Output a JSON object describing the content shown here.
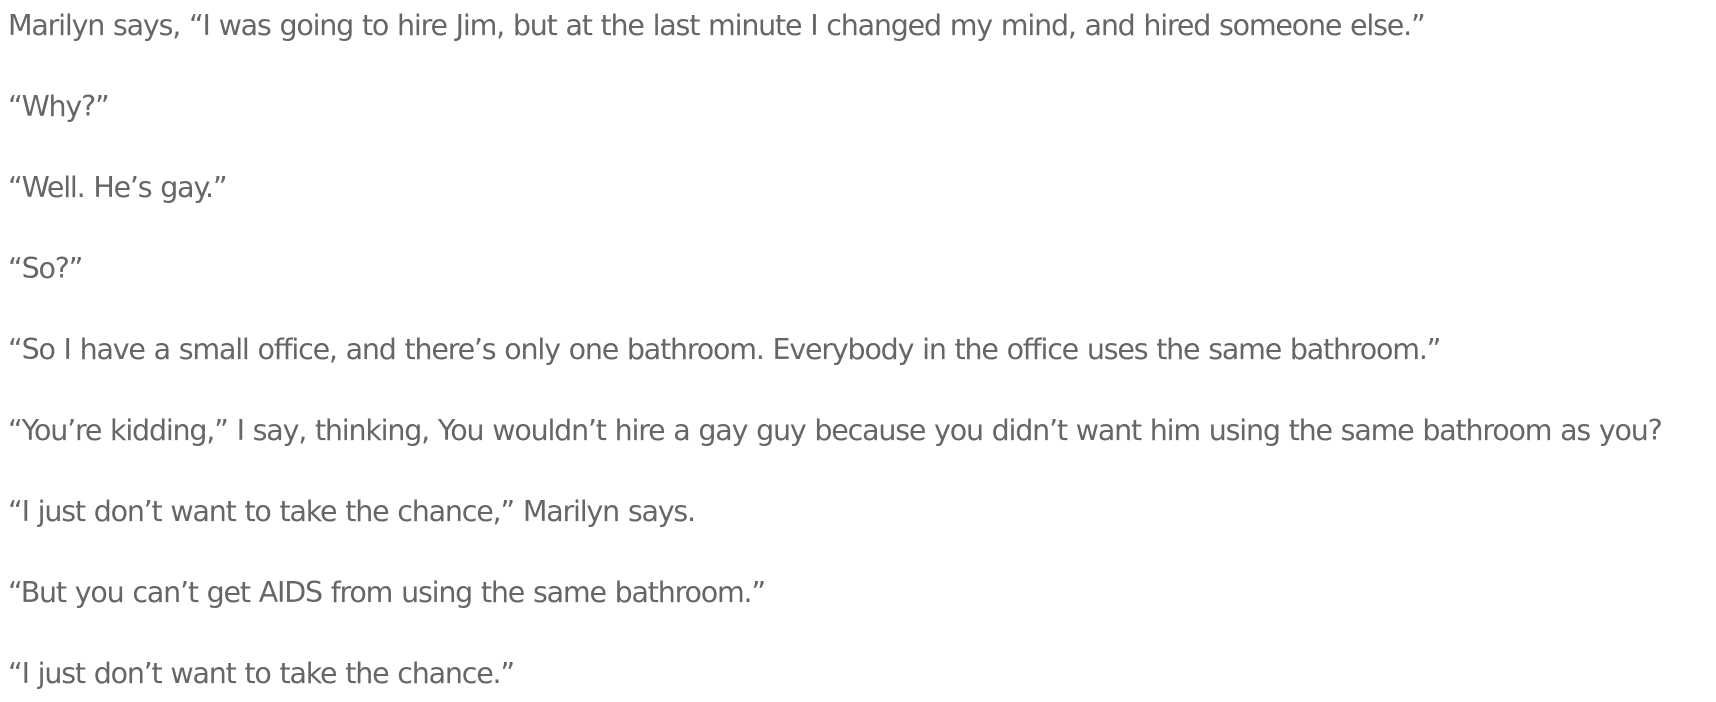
{
  "document": {
    "paragraphs": [
      "Marilyn says, “I was going to hire Jim, but at the last minute I changed my mind, and hired someone else.”",
      "“Why?”",
      "“Well. He’s gay.”",
      "“So?”",
      "“So I have a small office, and there’s only one bathroom. Everybody in the office uses the same bathroom.”",
      "“You’re kidding,” I say, thinking, You wouldn’t hire a gay guy because you didn’t want him using the same bathroom as you?",
      "“I just don’t want to take the chance,” Marilyn says.",
      "“But you can’t get AIDS from using the same bathroom.”",
      "“I just don’t want to take the chance.”"
    ]
  }
}
